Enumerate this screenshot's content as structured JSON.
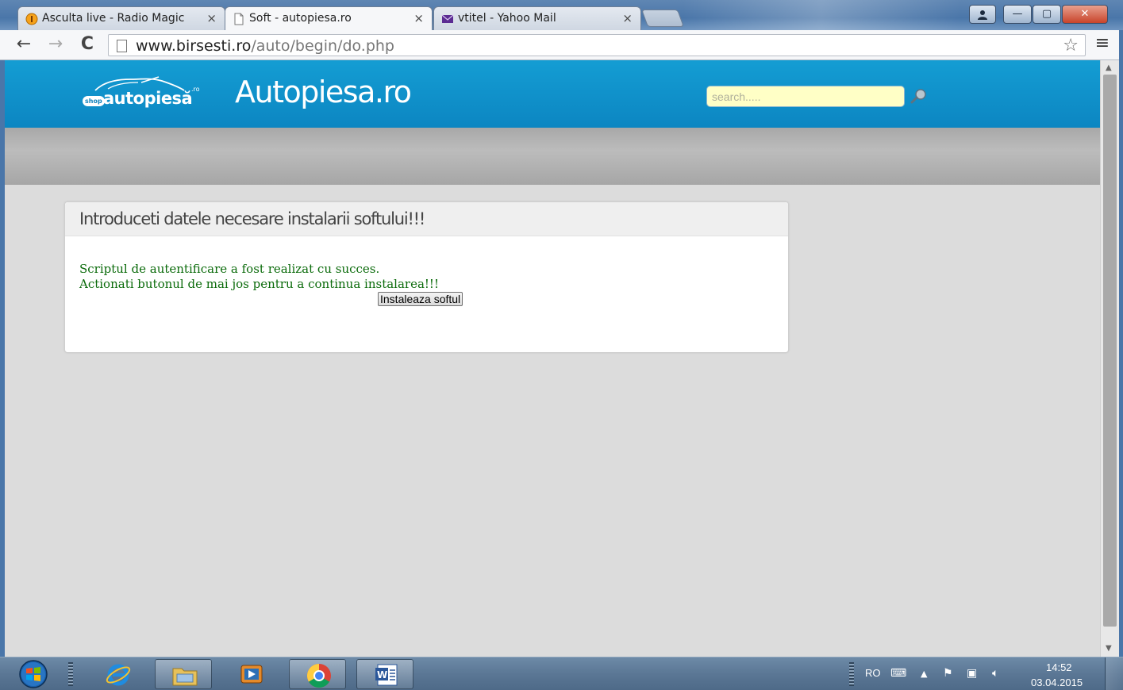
{
  "browser": {
    "tabs": [
      {
        "title": "Asculta live - Radio Magic",
        "active": false
      },
      {
        "title": "Soft - autopiesa.ro",
        "active": true
      },
      {
        "title": "vtitel - Yahoo Mail",
        "active": false
      }
    ],
    "tab_close_glyph": "×",
    "window_buttons": {
      "minimize": "—",
      "maximize": "▢",
      "close": "✕"
    },
    "nav": {
      "back": "←",
      "forward": "→",
      "reload": "C"
    },
    "url_host": "www.birsesti.ro",
    "url_path": "/auto/begin/do.php",
    "star_glyph": "☆",
    "menu_glyph": "≡"
  },
  "site": {
    "logo": {
      "shop_badge": "shop",
      "wordmark": "autopiesă",
      "superscript": ".ro"
    },
    "title": "Autopiesa.ro",
    "search_placeholder": "search....."
  },
  "panel": {
    "heading": "Introduceti datele necesare instalarii softului!!!",
    "line1": "Scriptul de autentificare a fost realizat cu succes.",
    "line2": "Actionati butonul de mai jos pentru a continua instalarea!!!",
    "button": "Instaleaza softul"
  },
  "taskbar": {
    "pinned": [
      "internet-explorer",
      "file-explorer",
      "media-player",
      "chrome",
      "word"
    ],
    "language": "RO",
    "time": "14:52",
    "date": "03.04.2015"
  },
  "colors": {
    "header_blue": "#149dd3",
    "success_green": "#0b6b0b",
    "search_bg": "#ffffc6"
  }
}
